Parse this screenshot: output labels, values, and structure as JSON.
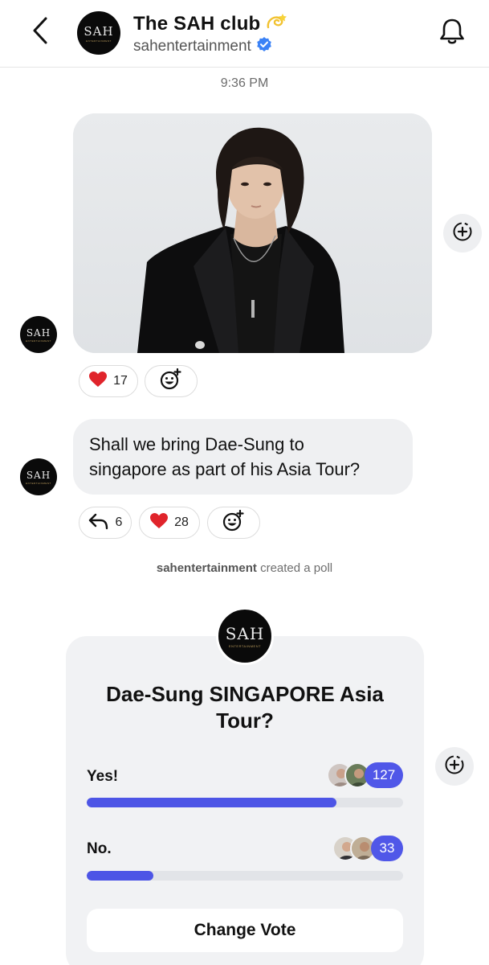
{
  "header": {
    "title": "The SAH club",
    "title_emoji_icon": "dizzy-icon",
    "handle": "sahentertainment",
    "verified_icon": "verified-badge-icon",
    "back_icon": "chevron-left-icon",
    "bell_icon": "bell-icon"
  },
  "logo": {
    "mark": "SAH",
    "tagline": "ENTERTAINMENT"
  },
  "timestamp": "9:36 PM",
  "photo_message": {
    "reactions": [
      {
        "icon": "heart-icon",
        "count": "17"
      },
      {
        "icon": "add-reaction-icon"
      }
    ]
  },
  "text_message": {
    "line1": "Shall we bring Dae-Sung to",
    "line2": "singapore as part of his Asia Tour?",
    "reactions": [
      {
        "icon": "reply-icon",
        "count": "6"
      },
      {
        "icon": "heart-icon",
        "count": "28"
      },
      {
        "icon": "add-reaction-icon"
      }
    ]
  },
  "system": {
    "user": "sahentertainment",
    "action": " created a poll"
  },
  "poll": {
    "question_line1": "Dae-Sung SINGAPORE Asia",
    "question_line2": "Tour?",
    "options": [
      {
        "label": "Yes!",
        "count": "127",
        "fraction": 0.79
      },
      {
        "label": "No.",
        "count": "33",
        "fraction": 0.21
      }
    ],
    "button": "Change Vote"
  },
  "colors": {
    "accent": "#4d55e6",
    "bubble": "#eff0f2",
    "heart": "#e0242b",
    "verified": "#3b82f6"
  }
}
